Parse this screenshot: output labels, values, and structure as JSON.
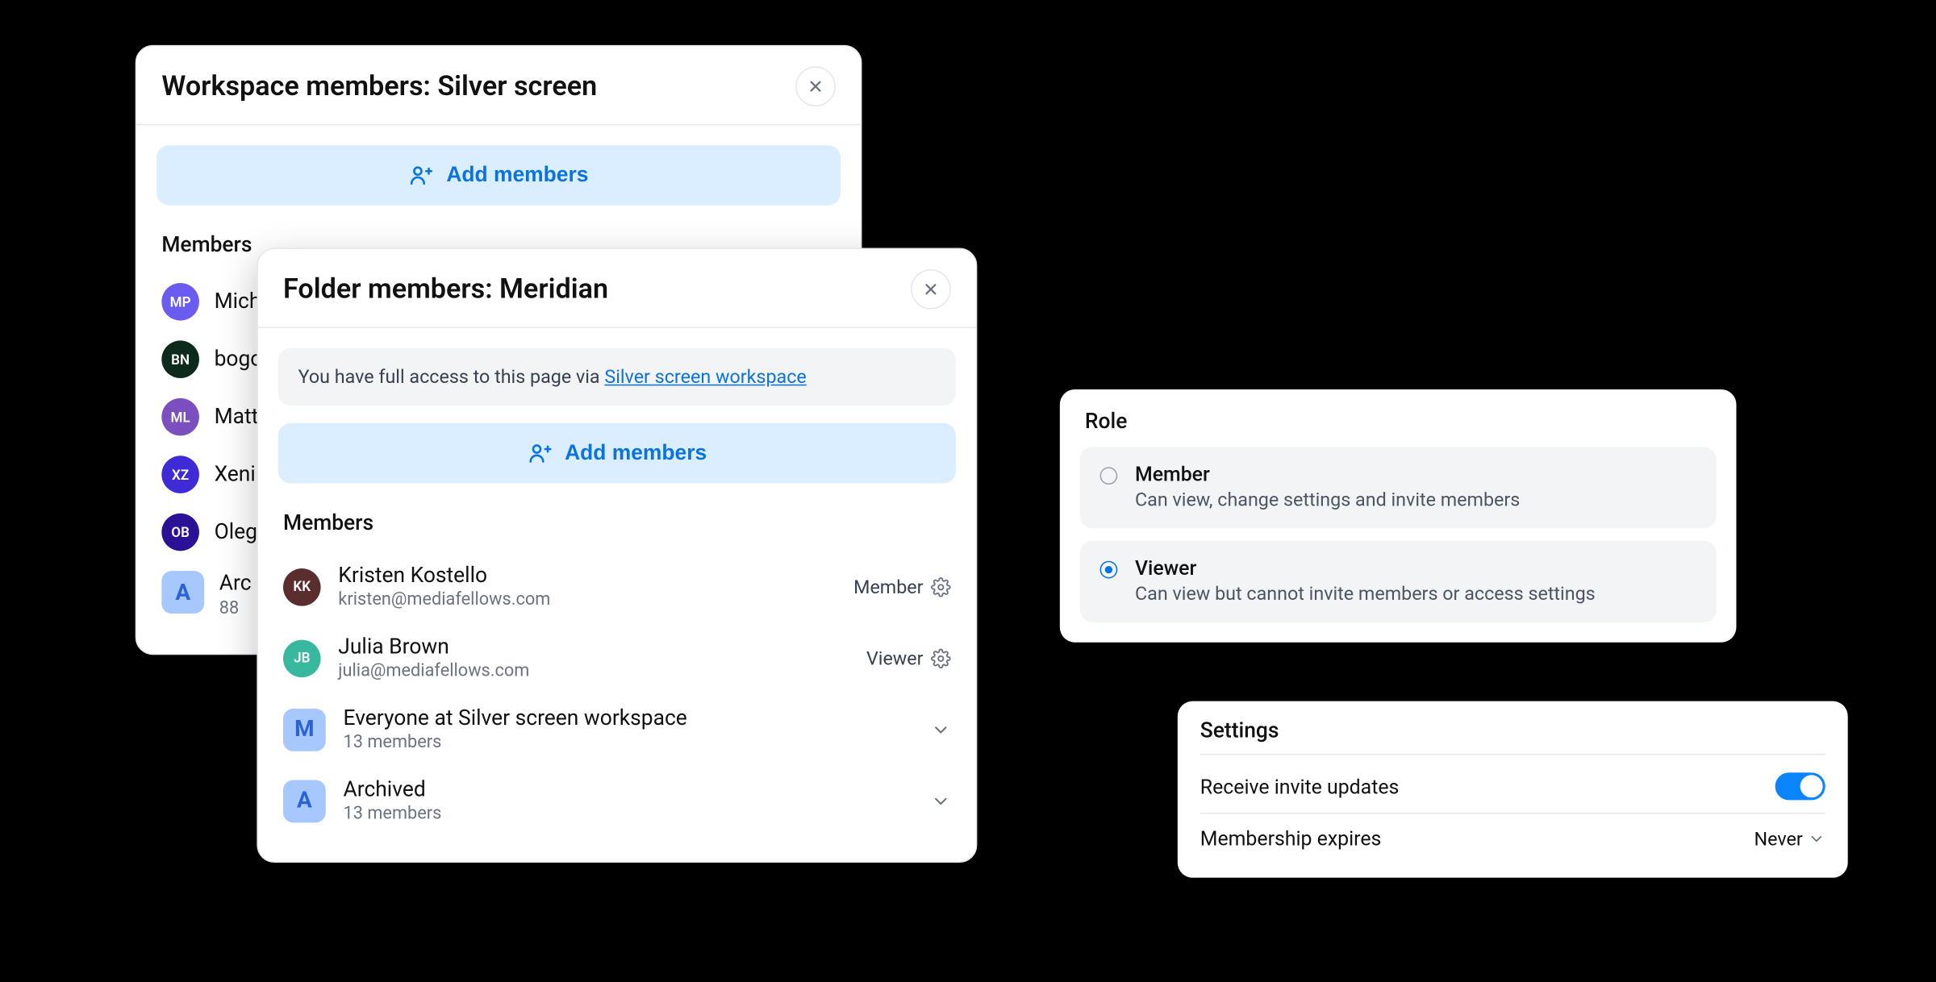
{
  "workspace_modal": {
    "title": "Workspace members: Silver screen",
    "add_button": "Add members",
    "members_label": "Members",
    "members": [
      {
        "initials": "MP",
        "name": "Mich",
        "color": "#6b5cf0"
      },
      {
        "initials": "BN",
        "name": "bogo",
        "color": "#0d2a1d"
      },
      {
        "initials": "ML",
        "name": "Matt",
        "color": "#7a4fbf"
      },
      {
        "initials": "XZ",
        "name": "Xeni",
        "color": "#3f2bd6"
      },
      {
        "initials": "OB",
        "name": "Oleg",
        "color": "#2a1196"
      }
    ],
    "archived": {
      "initials": "A",
      "name": "Arc",
      "sub": "88",
      "color": "#a7c7ff",
      "text_color": "#2b63d6"
    }
  },
  "folder_modal": {
    "title": "Folder members: Meridian",
    "banner_prefix": "You have full access to this page via ",
    "banner_link": "Silver screen workspace",
    "add_button": "Add members",
    "members_label": "Members",
    "members": [
      {
        "initials": "KK",
        "name": "Kristen Kostello",
        "sub": "kristen@mediafellows.com",
        "role": "Member",
        "color": "#5a2e2e"
      },
      {
        "initials": "JB",
        "name": "Julia Brown",
        "sub": "julia@mediafellows.com",
        "role": "Viewer",
        "color": "#39b8a0"
      }
    ],
    "groups": [
      {
        "initials": "M",
        "name": "Everyone at Silver screen workspace",
        "sub": "13 members",
        "color": "#a7c7ff",
        "text_color": "#2b63d6"
      },
      {
        "initials": "A",
        "name": "Archived",
        "sub": "13 members",
        "color": "#a7c7ff",
        "text_color": "#2b63d6"
      }
    ]
  },
  "role_card": {
    "title": "Role",
    "options": [
      {
        "name": "Member",
        "desc": "Can view, change settings and invite members",
        "selected": false
      },
      {
        "name": "Viewer",
        "desc": "Can view but cannot invite members or access settings",
        "selected": true
      }
    ]
  },
  "settings_card": {
    "title": "Settings",
    "invite_label": "Receive invite updates",
    "invite_on": true,
    "expires_label": "Membership expires",
    "expires_value": "Never"
  }
}
